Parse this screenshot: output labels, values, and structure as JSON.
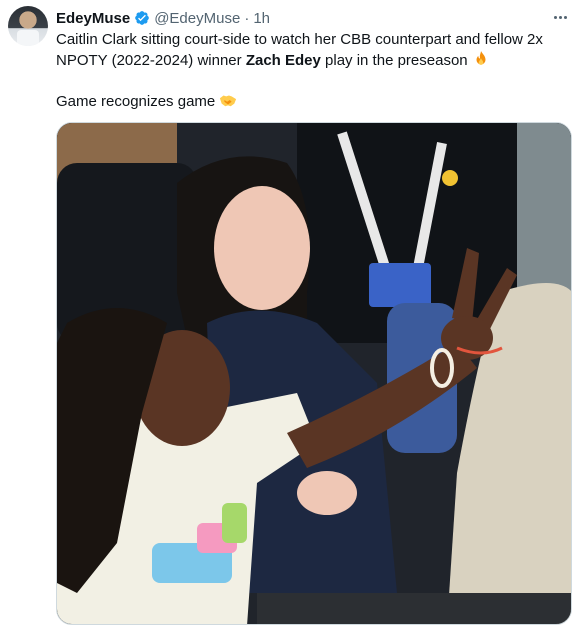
{
  "tweet": {
    "display_name": "EdeyMuse",
    "handle": "@EdeyMuse",
    "separator": "·",
    "time": "1h",
    "text_line1_before": "Caitlin Clark sitting court-side to watch her CBB counterpart and fellow 2x NPOTY (2022-2024) winner ",
    "text_line1_bold": "Zach Edey",
    "text_line1_after": " play in the preseason ",
    "text_line2": "Game recognizes game ",
    "verified_color": "#1d9bf0",
    "emojis": [
      "fire-emoji",
      "handshake-emoji"
    ]
  }
}
